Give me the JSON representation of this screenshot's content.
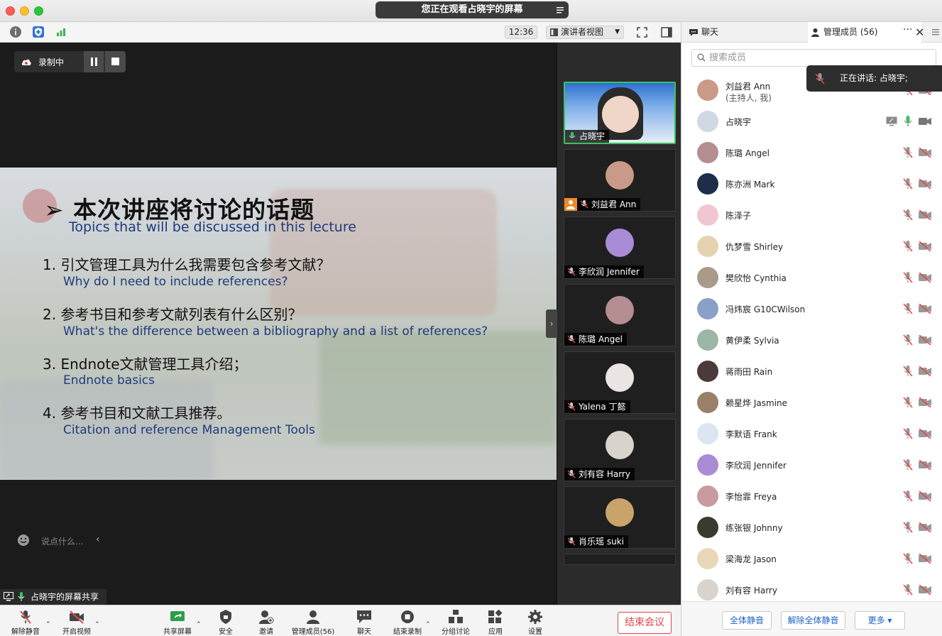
{
  "window": {
    "viewing_banner": "您正在观看占晓宇的屏幕"
  },
  "topbar": {
    "clock": "12:36",
    "view_mode": "演讲者视图"
  },
  "recording": {
    "label": "录制中"
  },
  "slide": {
    "title": "➢ 本次讲座将讨论的话题",
    "subtitle": "Topics that will be discussed in this lecture",
    "items": [
      {
        "cn": "1.  引文管理工具为什么我需要包含参考文献？",
        "en": "Why do I need to include references?"
      },
      {
        "cn": "2.  参考书目和参考文献列表有什么区别？",
        "en": "What's the difference between a bibliography and a list of references?"
      },
      {
        "cn": "3.  Endnote文献管理工具介绍；",
        "en": "Endnote basics"
      },
      {
        "cn": "4.  参考书目和文献工具推荐。",
        "en": "Citation and reference Management Tools"
      }
    ]
  },
  "chat_input": {
    "placeholder": "说点什么..."
  },
  "share_label": "占晓宇的屏幕共享",
  "gallery": [
    {
      "name": "占晓宇",
      "active": true,
      "avatar_color": "#7fa6d8"
    },
    {
      "name": "刘益君 Ann",
      "active": false,
      "avatar_color": "#c99a88",
      "host": true
    },
    {
      "name": "李欣润 Jennifer",
      "active": false,
      "avatar_color": "#a98bd6"
    },
    {
      "name": "陈璐 Angel",
      "active": false,
      "avatar_color": "#b58e92"
    },
    {
      "name": "Yalena 丁懿",
      "active": false,
      "avatar_color": "#eae4e4"
    },
    {
      "name": "刘有容 Harry",
      "active": false,
      "avatar_color": "#d8d4cc"
    },
    {
      "name": "肖乐瑶 suki",
      "active": false,
      "avatar_color": "#c9a36a"
    }
  ],
  "right_panel": {
    "tab_chat": "聊天",
    "tab_members": "管理成员 (56)",
    "more": "···",
    "close": "✕",
    "search_placeholder": "搜索成员",
    "members": [
      {
        "name": "刘益君 Ann",
        "sub": "(主持人, 我)",
        "avatar_color": "#c99a88"
      },
      {
        "name": "占晓宇",
        "avatar_color": "#cfd8e3"
      },
      {
        "name": "陈璐 Angel",
        "avatar_color": "#b58e92"
      },
      {
        "name": "陈亦洲 Mark",
        "avatar_color": "#1e2e48"
      },
      {
        "name": "陈泽子",
        "avatar_color": "#f2c6d0"
      },
      {
        "name": "仇梦雪 Shirley",
        "avatar_color": "#e5d3b0"
      },
      {
        "name": "樊欣怡 Cynthia",
        "avatar_color": "#a99a8a"
      },
      {
        "name": "冯炜宸 G10CWilson",
        "avatar_color": "#8aa0c8"
      },
      {
        "name": "黄伊柔 Sylvia",
        "avatar_color": "#9cb6a8"
      },
      {
        "name": "蒋雨田 Rain",
        "avatar_color": "#4a3a3a"
      },
      {
        "name": "赖星烨 Jasmine",
        "avatar_color": "#9a8068"
      },
      {
        "name": "李默语 Frank",
        "avatar_color": "#dbe6f0"
      },
      {
        "name": "李欣润 Jennifer",
        "avatar_color": "#a98bd6"
      },
      {
        "name": "李怡霏 Freya",
        "avatar_color": "#c99aa0"
      },
      {
        "name": "练张银 Johnny",
        "avatar_color": "#3a3a30"
      },
      {
        "name": "梁海龙 Jason",
        "avatar_color": "#e8d8b8"
      },
      {
        "name": "刘有容 Harry",
        "avatar_color": "#d8d4cc"
      }
    ],
    "speaking": "正在讲话: 占晓宇;",
    "footer": {
      "mute_all": "全体静音",
      "unmute_all": "解除全体静音",
      "more": "更多 ▾"
    }
  },
  "bottombar": {
    "unmute": "解除静音",
    "start_video": "开启视频",
    "share_screen": "共享屏幕",
    "security": "安全",
    "invite": "邀请",
    "members": "管理成员(56)",
    "chat": "聊天",
    "end_recording": "结束录制",
    "breakout": "分组讨论",
    "apps": "应用",
    "settings": "设置",
    "end_meeting": "结束会议"
  },
  "colors": {
    "accent_green": "#39c45b",
    "end_red": "#e04848",
    "link_blue": "#1d62c9"
  }
}
